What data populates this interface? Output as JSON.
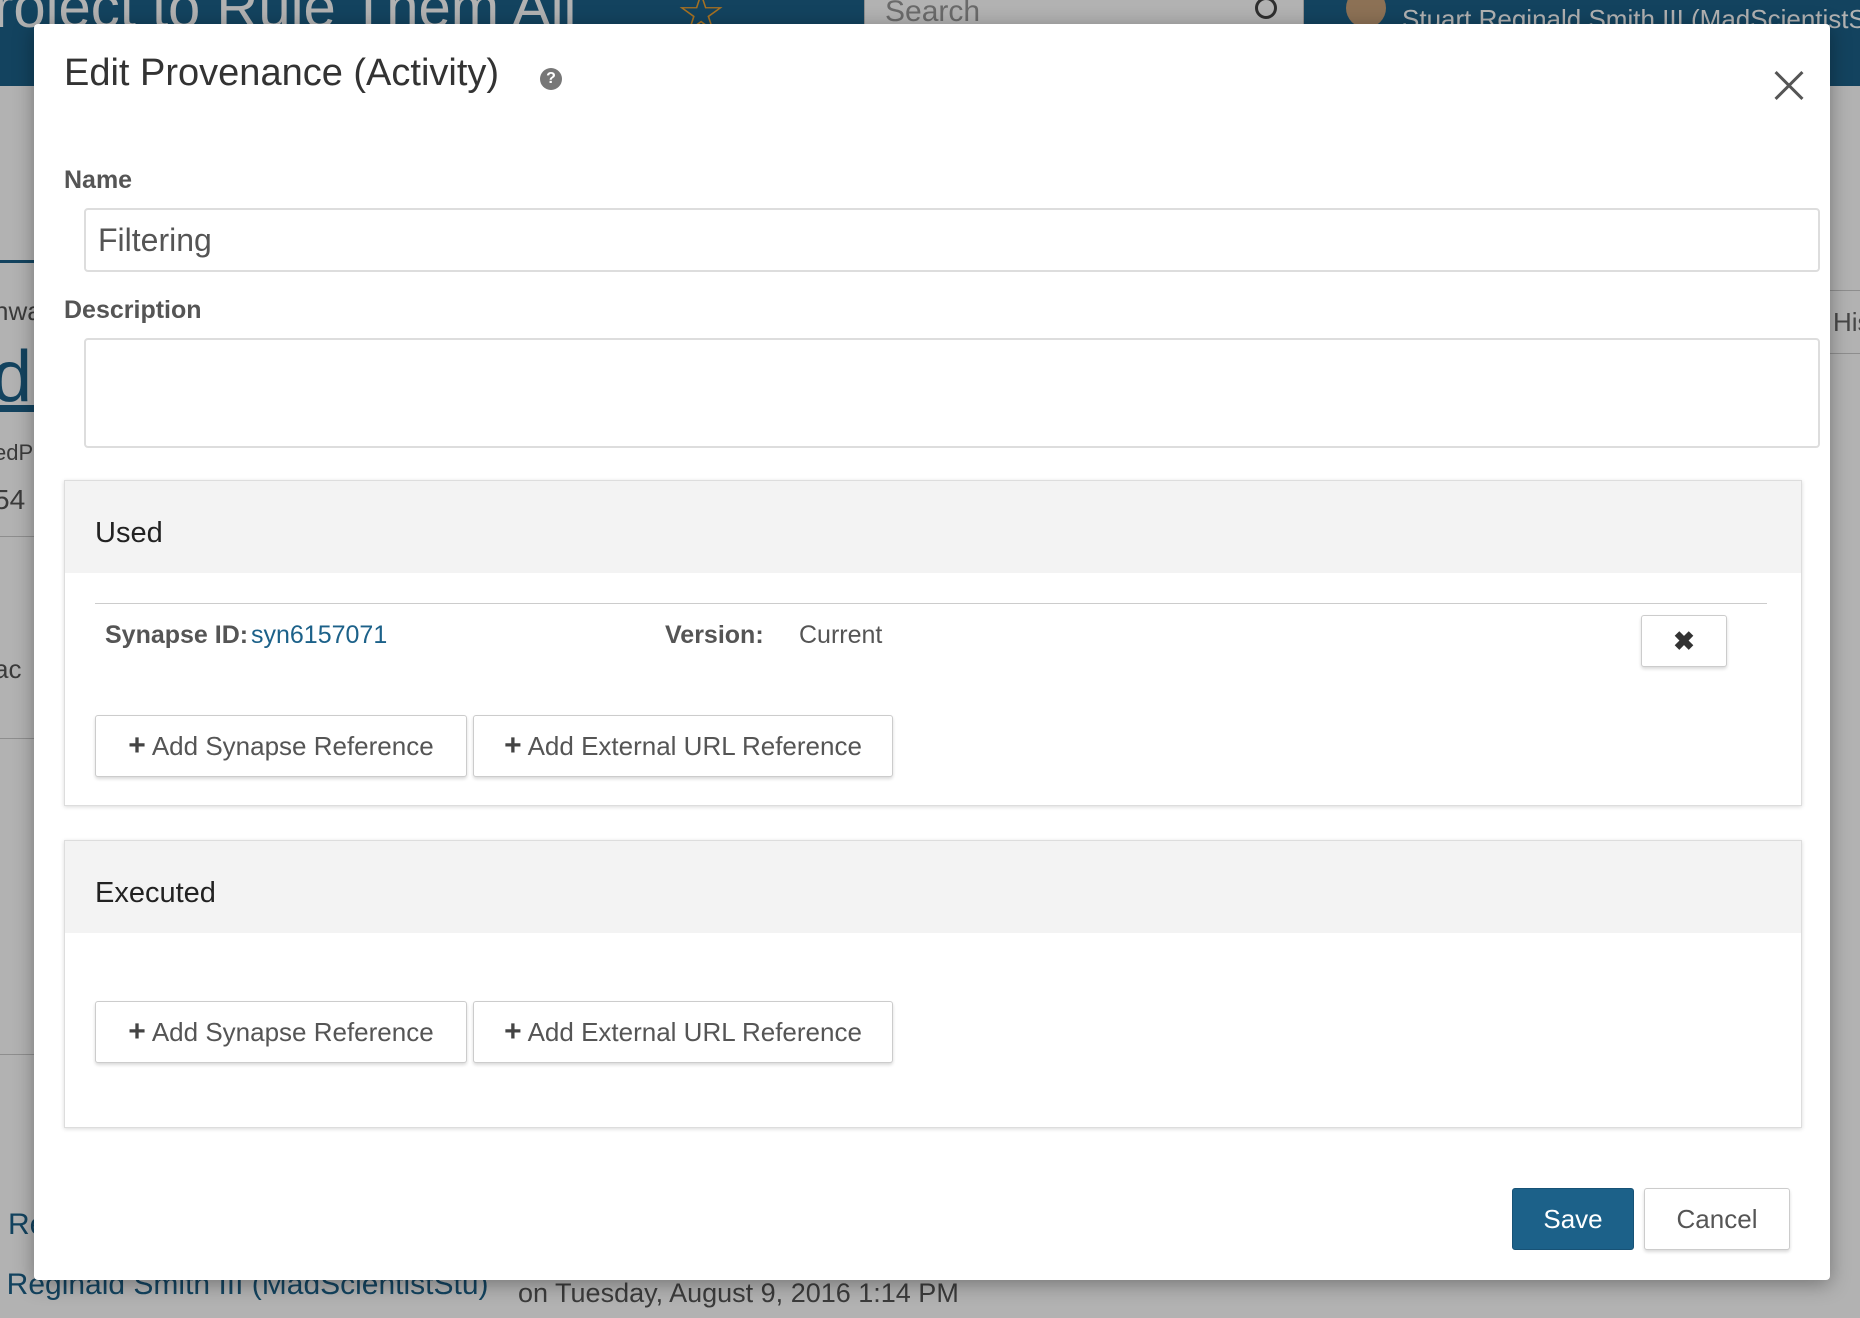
{
  "background": {
    "project_title": "roject to Rule Them All",
    "star_icon": "star-icon",
    "search_placeholder": "Search",
    "user_name": "Stuart Reginald Smith III (MadScientistStu",
    "fragments": [
      "nwa",
      "edP",
      "54",
      "ac",
      "Re"
    ],
    "big_link_fragment": "dF",
    "history_tab": "His",
    "footer_user": "t Reginald Smith III (MadScientistStu)",
    "footer_date": "on Tuesday, August 9, 2016 1:14 PM"
  },
  "modal": {
    "title": "Edit Provenance (Activity)",
    "help_icon": "?",
    "close_icon": "close-icon",
    "name_label": "Name",
    "name_value": "Filtering",
    "description_label": "Description",
    "description_value": "",
    "used": {
      "title": "Used",
      "references": [
        {
          "id_label": "Synapse ID:",
          "id_value": "syn6157071",
          "version_label": "Version:",
          "version_value": "Current",
          "remove_label": "✖"
        }
      ],
      "add_synapse_label": "Add Synapse Reference",
      "add_url_label": "Add External URL Reference"
    },
    "executed": {
      "title": "Executed",
      "add_synapse_label": "Add Synapse Reference",
      "add_url_label": "Add External URL Reference"
    },
    "save_label": "Save",
    "cancel_label": "Cancel"
  },
  "colors": {
    "accent": "#1c6189",
    "panel_header": "#f3f3f3",
    "star": "#f0a330"
  }
}
